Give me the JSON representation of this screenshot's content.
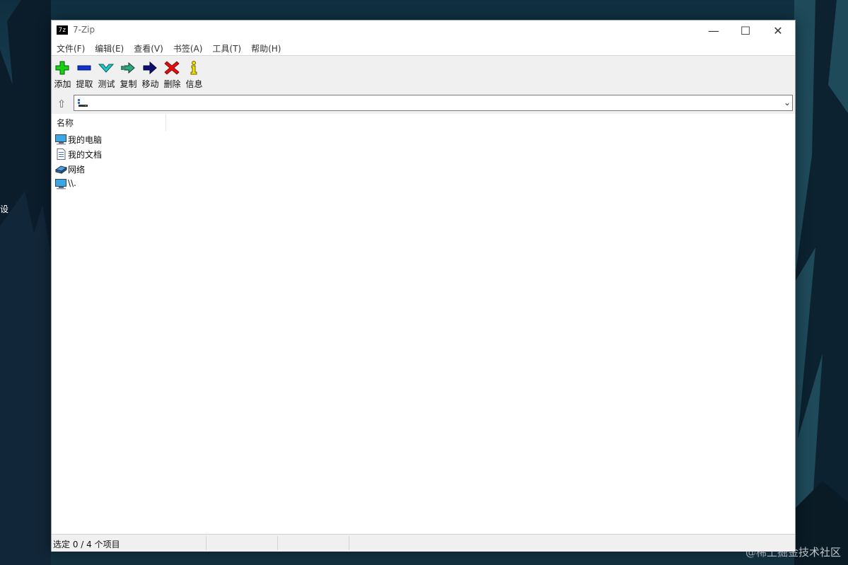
{
  "desktop": {
    "left_edge_text": "设",
    "watermark": "@稀土掘金技术社区"
  },
  "window": {
    "app_icon_text": "7z",
    "title": "7-Zip",
    "controls": {
      "minimize": "—",
      "maximize": "☐",
      "close": "✕"
    }
  },
  "menu": [
    {
      "label": "文件(F)"
    },
    {
      "label": "编辑(E)"
    },
    {
      "label": "查看(V)"
    },
    {
      "label": "书签(A)"
    },
    {
      "label": "工具(T)"
    },
    {
      "label": "帮助(H)"
    }
  ],
  "toolbar": {
    "add": "添加",
    "extract": "提取",
    "test": "测试",
    "copy": "复制",
    "move": "移动",
    "delete": "删除",
    "info": "信息"
  },
  "address": {
    "up_icon": "⇧",
    "path": "",
    "dropdown_icon": "⌄"
  },
  "filelist": {
    "column_name": "名称",
    "items": [
      {
        "name": "我的电脑",
        "icon": "computer-icon"
      },
      {
        "name": "我的文档",
        "icon": "document-icon"
      },
      {
        "name": "网络",
        "icon": "network-icon"
      },
      {
        "name": "\\\\.",
        "icon": "computer-icon"
      }
    ]
  },
  "status": {
    "selection": "选定 0 / 4 个项目"
  },
  "colors": {
    "window_bg": "#ffffff",
    "toolbar_bg": "#f0f0f0",
    "add_green": "#17d017",
    "extract_blue": "#1030d8",
    "test_cyan": "#20c8c8",
    "move_navy": "#101070",
    "delete_red": "#e01010",
    "info_yellow": "#f2e200"
  }
}
